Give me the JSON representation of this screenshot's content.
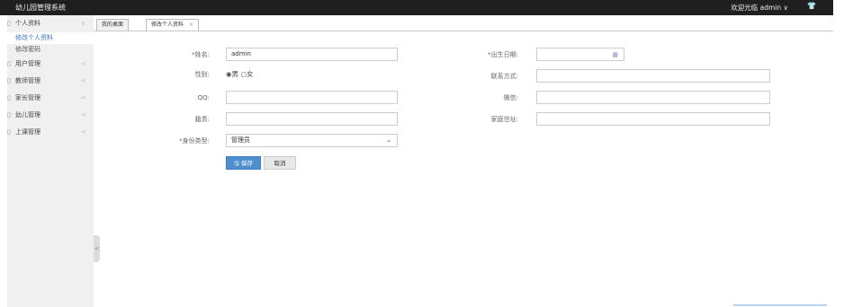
{
  "app": {
    "title": "幼儿园管理系统",
    "welcome": "欢迎光临",
    "username": "admin",
    "dropdown_glyph": "∨",
    "shirt_glyph": "👕"
  },
  "sidebar": {
    "items": [
      {
        "label": "个人资料",
        "arrow": "∨",
        "subitems": [
          {
            "label": "修改个人资料",
            "active": true
          },
          {
            "label": "修改密码",
            "active": false
          }
        ]
      },
      {
        "label": "用户管理",
        "arrow": "<"
      },
      {
        "label": "教师管理",
        "arrow": "<"
      },
      {
        "label": "家长管理",
        "arrow": "<"
      },
      {
        "label": "幼儿管理",
        "arrow": "<"
      },
      {
        "label": "上课管理",
        "arrow": "<"
      }
    ],
    "collapse_glyph": "<"
  },
  "tabs": [
    {
      "label": "我的桌面",
      "closable": false,
      "active": false
    },
    {
      "label": "修改个人资料",
      "closable": true,
      "close_glyph": "×",
      "active": true
    }
  ],
  "form": {
    "name_label": "*姓名:",
    "name_value": "admin",
    "birth_label": "*出生日期:",
    "birth_value": "",
    "gender_label": "性别:",
    "gender_options": [
      "男",
      "女"
    ],
    "gender_selected": "男",
    "contact_label": "联系方式:",
    "contact_value": "",
    "qq_label": "QQ:",
    "qq_value": "",
    "wechat_label": "微信:",
    "wechat_value": "",
    "native_label": "籍贯:",
    "native_value": "",
    "address_label": "家庭住址:",
    "address_value": "",
    "identity_label": "*身份类型:",
    "identity_value": "管理员"
  },
  "buttons": {
    "save": "保存",
    "save_icon": "🖫",
    "cancel": "取消"
  },
  "colors": {
    "topbar": "#1f1f1f",
    "sidebar": "#f0f0f0",
    "primary": "#4f8fcf",
    "active_text": "#3a78b7"
  }
}
